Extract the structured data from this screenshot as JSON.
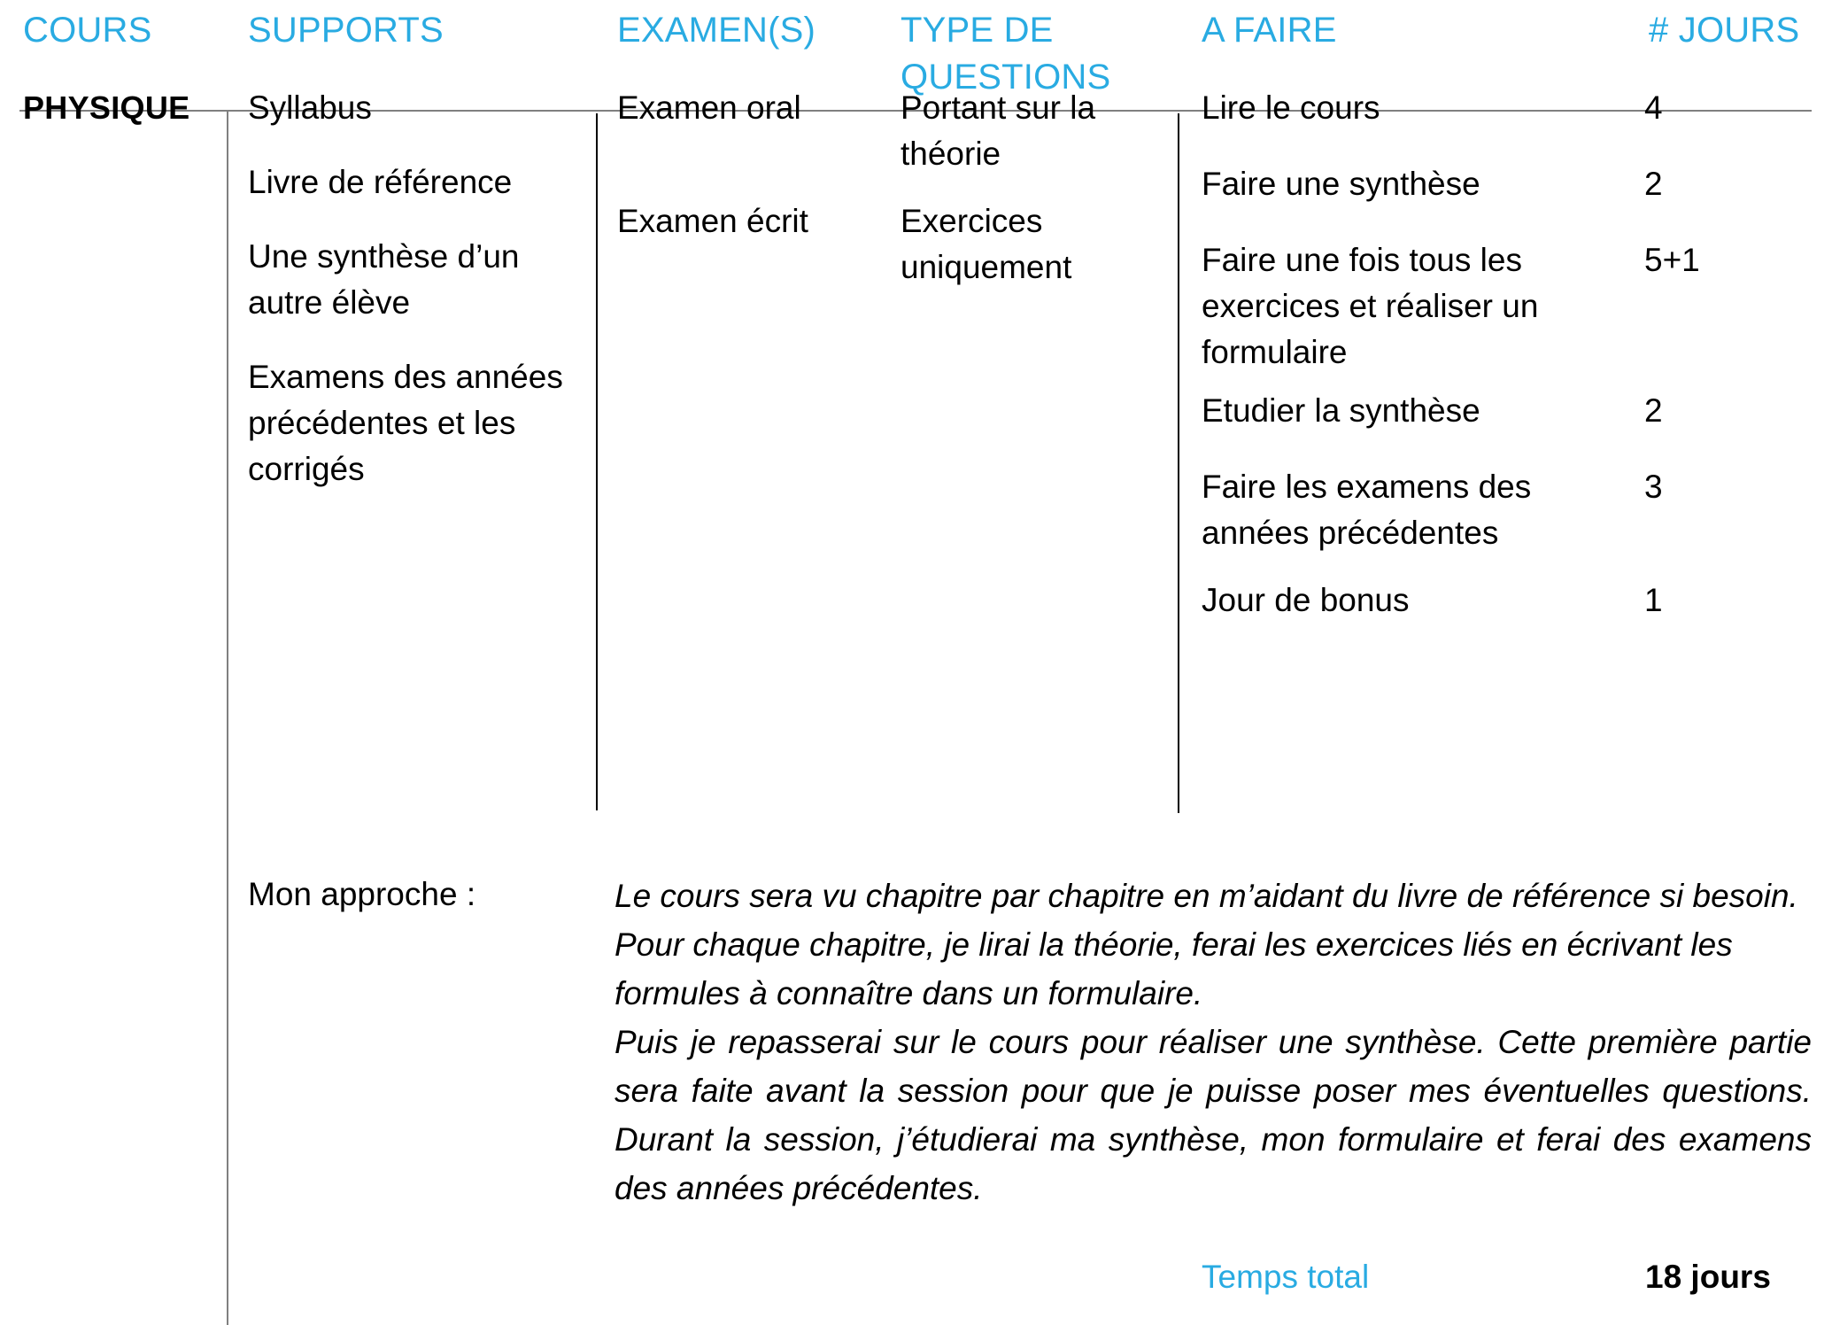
{
  "colors": {
    "accent": "#29ABE2",
    "text": "#000000",
    "rule": "#808080"
  },
  "table": {
    "headers": {
      "cours": "COURS",
      "supports": "SUPPORTS",
      "examens": "EXAMEN(S)",
      "type_questions": "TYPE DE\nQUESTIONS",
      "a_faire": "A FAIRE",
      "jours": "# JOURS"
    },
    "row": {
      "cours": "PHYSIQUE",
      "supports": [
        "Syllabus",
        "Livre de référence",
        "Une synthèse d’un autre élève",
        "Examens des années précédentes et les corrigés"
      ],
      "examens": [
        "Examen oral",
        "Examen écrit"
      ],
      "type_questions": [
        "Portant sur la théorie",
        "Exercices uniquement"
      ],
      "tasks": [
        {
          "label": "Lire le cours",
          "days": "4"
        },
        {
          "label": "Faire une synthèse",
          "days": "2"
        },
        {
          "label": "Faire une fois tous les exercices et réaliser un formulaire",
          "days": "5+1"
        },
        {
          "label": "Etudier la synthèse",
          "days": "2"
        },
        {
          "label": "Faire les examens des années précédentes",
          "days": "3"
        },
        {
          "label": "Jour de bonus",
          "days": "1"
        }
      ]
    },
    "approach": {
      "label": "Mon approche :",
      "paragraphs": [
        "Le cours sera vu chapitre par chapitre en m’aidant du livre de référence si besoin. Pour chaque chapitre, je lirai la théorie, ferai les exercices liés en écrivant les formules à connaître dans un formulaire.",
        "Puis je repasserai sur le cours pour réaliser une synthèse. Cette première partie sera faite avant la session pour que je puisse poser mes éventuelles questions.  Durant la session, j’étudierai ma synthèse, mon formulaire et ferai des examens des années précédentes."
      ]
    },
    "total": {
      "label": "Temps total",
      "value": "18 jours"
    }
  }
}
